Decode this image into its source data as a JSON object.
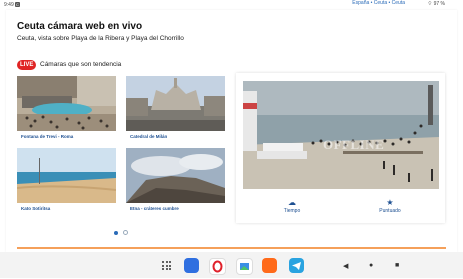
{
  "status": {
    "time": "9:49",
    "crumbs": "España • Ceuta • Ceuta",
    "battery": "97 %"
  },
  "header": {
    "title": "Ceuta cámara web en vivo",
    "subtitle": "Ceuta, vista sobre Playa de la Ribera y Playa del Chorrillo"
  },
  "trending": {
    "badge": "LIVE",
    "label": "Cámaras que son tendencia",
    "items": [
      {
        "caption": "Fontana de Trevi - Roma"
      },
      {
        "caption": "Catedral de Milán"
      },
      {
        "caption": "Kato Sotiritsa"
      },
      {
        "caption": "Etna - cráteres cumbre"
      }
    ]
  },
  "player": {
    "overlay": "OFFLINE",
    "weather_label": "Tiempo",
    "rating_label": "Puntuado"
  },
  "colors": {
    "accent": "#1d4f91",
    "live": "#e02424",
    "divider": "#f5a05a"
  },
  "dock": {
    "icons": [
      "apps-grid-icon",
      "app-store-icon",
      "opera-icon",
      "photos-icon",
      "speedtest-icon",
      "telegram-icon"
    ],
    "nav": [
      "back-icon",
      "home-icon",
      "recents-icon"
    ]
  }
}
